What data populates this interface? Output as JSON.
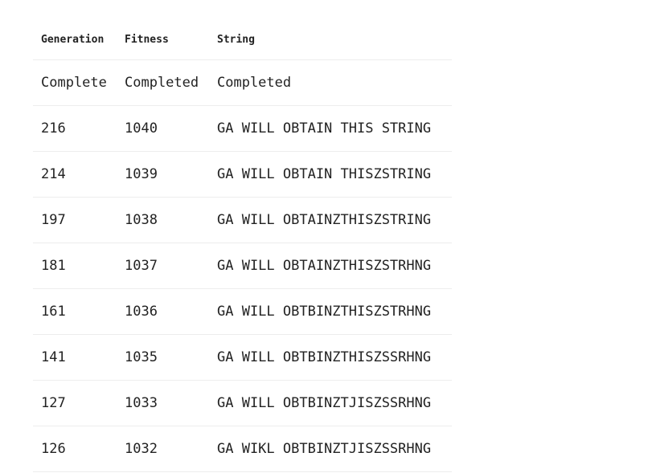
{
  "table": {
    "headers": {
      "generation": "Generation",
      "fitness": "Fitness",
      "string": "String"
    },
    "rows": [
      {
        "generation": "Complete",
        "fitness": "Completed",
        "string": "Completed"
      },
      {
        "generation": "216",
        "fitness": "1040",
        "string": "GA WILL OBTAIN THIS STRING"
      },
      {
        "generation": "214",
        "fitness": "1039",
        "string": "GA WILL OBTAIN THISZSTRING"
      },
      {
        "generation": "197",
        "fitness": "1038",
        "string": "GA WILL OBTAINZTHISZSTRING"
      },
      {
        "generation": "181",
        "fitness": "1037",
        "string": "GA WILL OBTAINZTHISZSTRHNG"
      },
      {
        "generation": "161",
        "fitness": "1036",
        "string": "GA WILL OBTBINZTHISZSTRHNG"
      },
      {
        "generation": "141",
        "fitness": "1035",
        "string": "GA WILL OBTBINZTHISZSSRHNG"
      },
      {
        "generation": "127",
        "fitness": "1033",
        "string": "GA WILL OBTBINZTJISZSSRHNG"
      },
      {
        "generation": "126",
        "fitness": "1032",
        "string": "GA WIKL OBTBINZTJISZSSRHNG"
      }
    ]
  }
}
